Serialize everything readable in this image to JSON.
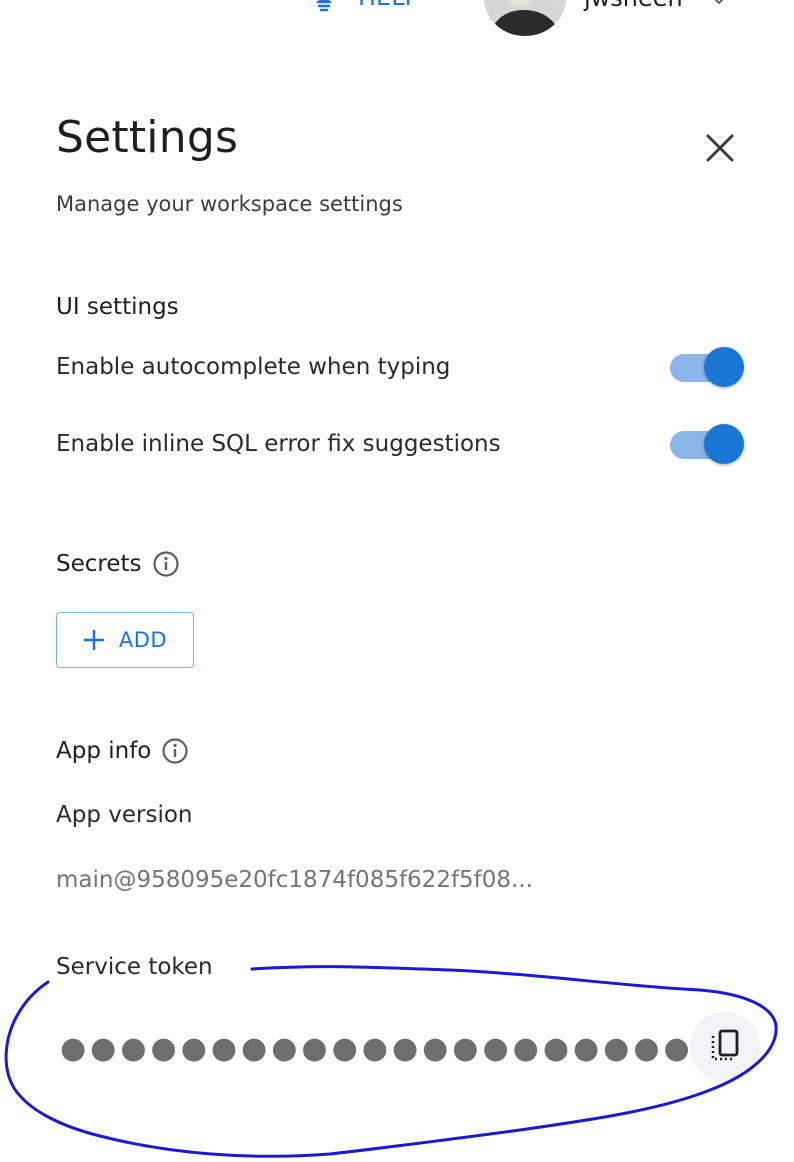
{
  "topbar": {
    "help_label": "HELP",
    "username": "jwsheen"
  },
  "header": {
    "title": "Settings",
    "subtitle": "Manage your workspace settings"
  },
  "ui_settings": {
    "heading": "UI settings",
    "items": [
      {
        "label": "Enable autocomplete when typing",
        "enabled": true
      },
      {
        "label": "Enable inline SQL error fix suggestions",
        "enabled": true
      }
    ]
  },
  "secrets": {
    "heading": "Secrets",
    "add_label": "ADD"
  },
  "app_info": {
    "heading": "App info",
    "version_label": "App version",
    "version_value": "main@958095e20fc1874f085f622f5f08...",
    "token_label": "Service token",
    "token_masked": "●●●●●●●●●●●●●●●●●●●●●"
  },
  "colors": {
    "accent": "#1a73e8",
    "toggle_thumb": "#1976d2",
    "toggle_track": "#8ab6ea",
    "annotation": "#1a1ad6"
  },
  "icons": {
    "help": "lightbulb-icon",
    "close": "close-icon",
    "info": "info-icon",
    "add": "plus-icon",
    "copy": "copy-icon",
    "chevron": "chevron-down-icon"
  }
}
